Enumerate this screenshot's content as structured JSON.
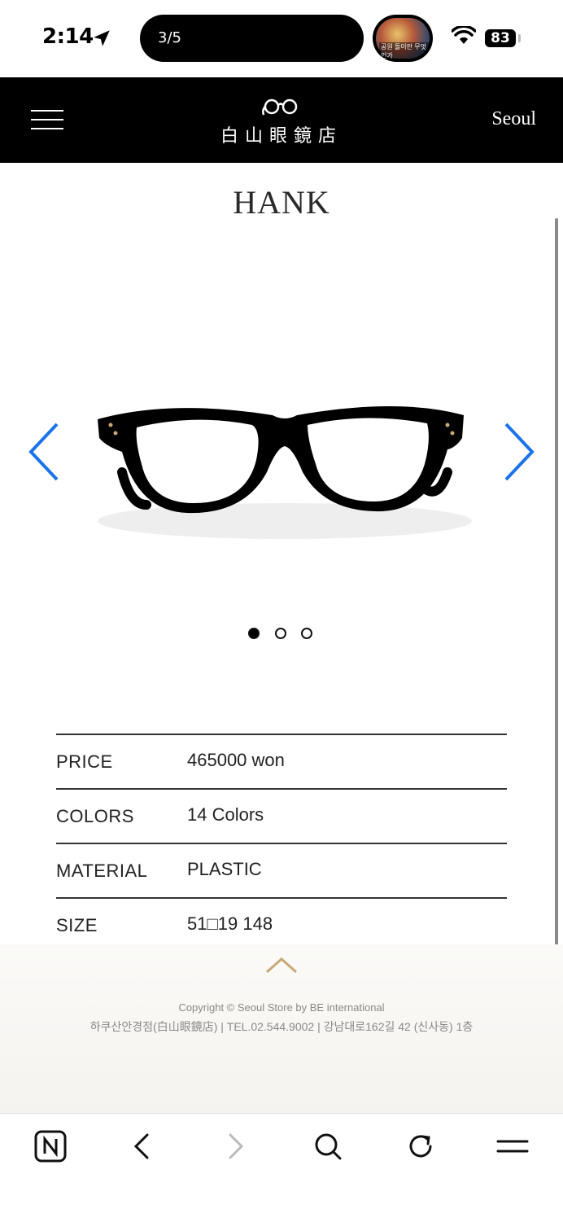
{
  "status": {
    "time": "2:14",
    "island_text": "3/5",
    "pip_caption": "공원 돌이란 무엇인가",
    "battery": "83"
  },
  "header": {
    "logo_text": "白山眼鏡店",
    "city": "Seoul"
  },
  "product": {
    "name": "HANK",
    "carousel_total": 3,
    "carousel_active": 1
  },
  "specs": [
    {
      "label": "PRICE",
      "value": "465000 won"
    },
    {
      "label": "COLORS",
      "value": "14 Colors"
    },
    {
      "label": "MATERIAL",
      "value": "PLASTIC"
    },
    {
      "label": "SIZE",
      "value": "51□19   148"
    }
  ],
  "footer": {
    "copyright": "Copyright © Seoul Store by BE international",
    "address": "하쿠산안경점(白山眼鏡店) | TEL.02.544.9002 | 강남대로162길 42 (신사동) 1층"
  },
  "colors": {
    "accent_blue": "#1a73e8",
    "chevron_gold": "#c9a878"
  }
}
